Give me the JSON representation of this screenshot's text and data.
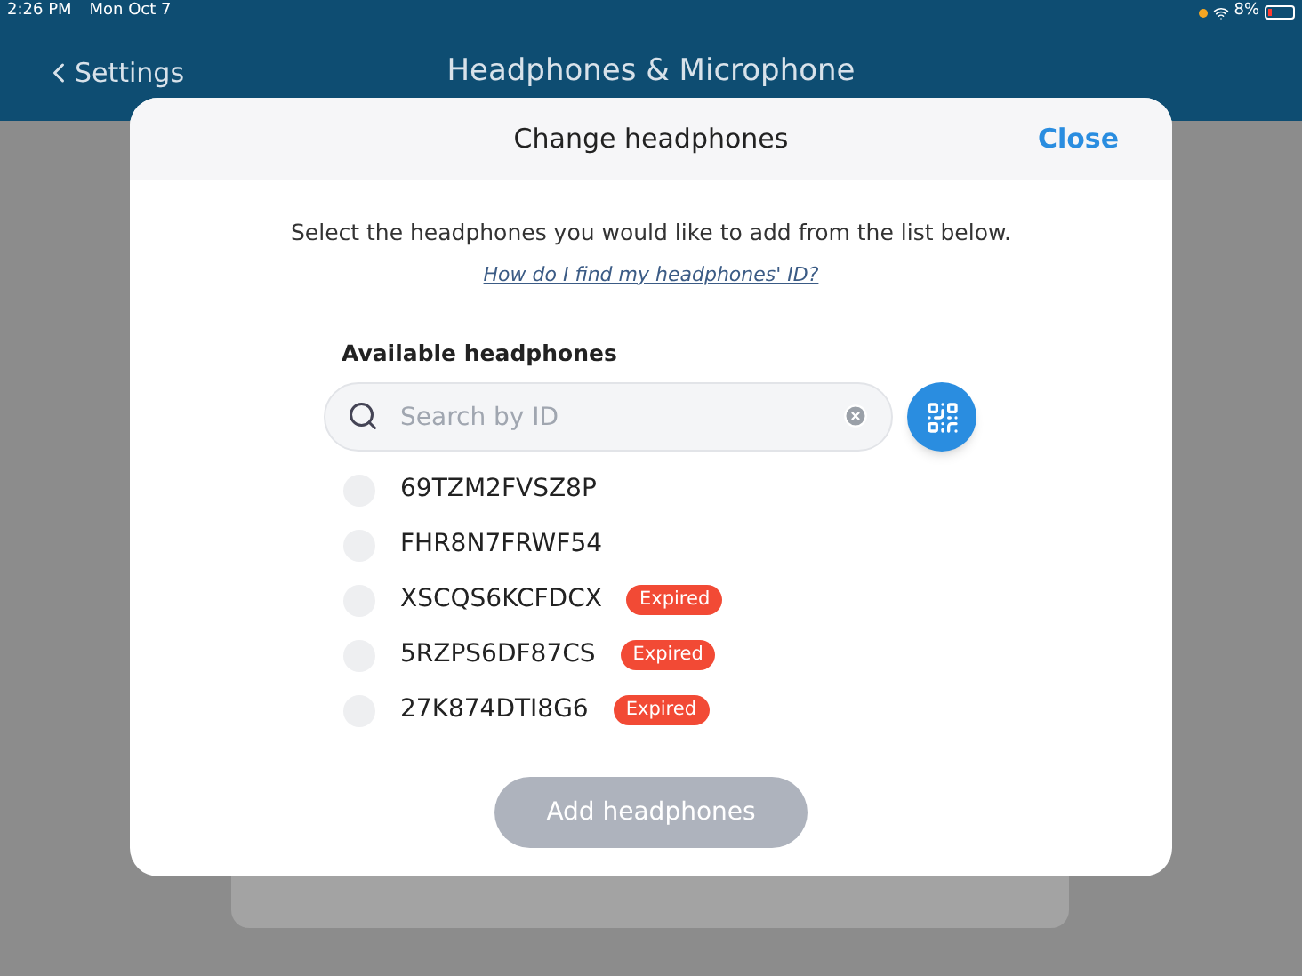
{
  "status_bar": {
    "time": "2:26 PM",
    "date": "Mon Oct 7",
    "battery": "8%"
  },
  "nav": {
    "back": "Settings",
    "title": "Headphones & Microphone"
  },
  "dialog": {
    "title": "Change headphones",
    "close": "Close",
    "instruction": "Select the headphones you would like to add from the list below.",
    "help_link": "How do I find my headphones' ID?",
    "list_label": "Available headphones",
    "search": {
      "placeholder": "Search by ID"
    },
    "items": [
      {
        "id": "69TZM2FVSZ8P",
        "selected": false
      },
      {
        "id": "FHR8N7FRWF54",
        "selected": false
      },
      {
        "id": "XSCQS6KCFDCX",
        "selected": false,
        "badge": "Expired"
      },
      {
        "id": "5RZPS6DF87CS",
        "selected": false,
        "badge": "Expired"
      },
      {
        "id": "27K874DTI8G6",
        "selected": false,
        "badge": "Expired"
      }
    ],
    "add_button": {
      "label": "Add headphones",
      "disabled": true
    }
  }
}
